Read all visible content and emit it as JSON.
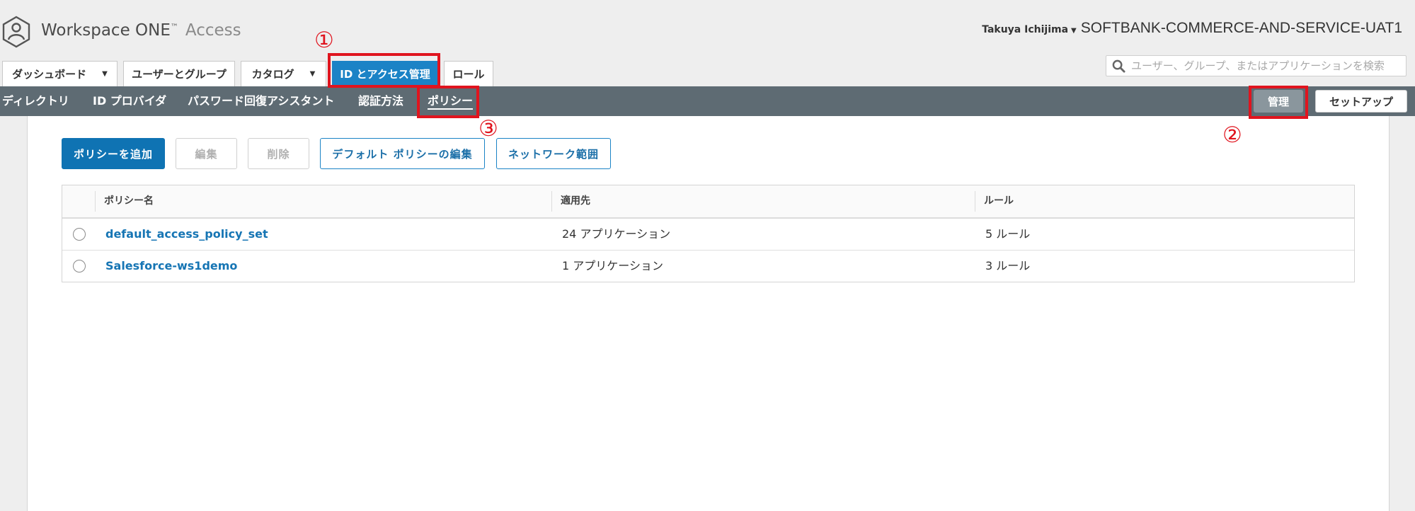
{
  "header": {
    "brand_main": "Workspace ONE",
    "brand_tm": "™",
    "brand_sub": "Access",
    "user_name": "Takuya Ichijima",
    "tenant": "SOFTBANK-COMMERCE-AND-SERVICE-UAT1",
    "search_placeholder": "ユーザー、グループ、またはアプリケーションを検索"
  },
  "tabs": [
    {
      "label": "ダッシュボード",
      "dropdown": true
    },
    {
      "label": "ユーザーとグループ",
      "dropdown": false
    },
    {
      "label": "カタログ",
      "dropdown": true
    },
    {
      "label": "ID とアクセス管理",
      "dropdown": false,
      "active": true
    },
    {
      "label": "ロール",
      "dropdown": false
    }
  ],
  "subnav": {
    "items": [
      "ディレクトリ",
      "ID プロバイダ",
      "パスワード回復アシスタント",
      "認証方法",
      "ポリシー"
    ],
    "active": "ポリシー",
    "manage_label": "管理",
    "setup_label": "セットアップ"
  },
  "toolbar": {
    "add_label": "ポリシーを追加",
    "edit_label": "編集",
    "delete_label": "削除",
    "default_policy_label": "デフォルト ポリシーの編集",
    "network_range_label": "ネットワーク範囲"
  },
  "table": {
    "columns": [
      "ポリシー名",
      "適用先",
      "ルール"
    ],
    "rows": [
      {
        "name": "default_access_policy_set",
        "applies_to": "24 アプリケーション",
        "rules": "5 ルール"
      },
      {
        "name": "Salesforce-ws1demo",
        "applies_to": "1 アプリケーション",
        "rules": "3 ルール"
      }
    ]
  },
  "annotations": {
    "marker_1": "①",
    "marker_2": "②",
    "marker_3": "③",
    "color": "#e0141e"
  },
  "colors": {
    "accent_blue": "#1b83c6",
    "primary_button": "#0f73b3",
    "subnav_bg": "#5e6b73",
    "link": "#1675b4"
  },
  "icons": {
    "logo": "workspace-one-logo-icon",
    "search": "search-icon",
    "dropdown": "caret-down-icon"
  }
}
